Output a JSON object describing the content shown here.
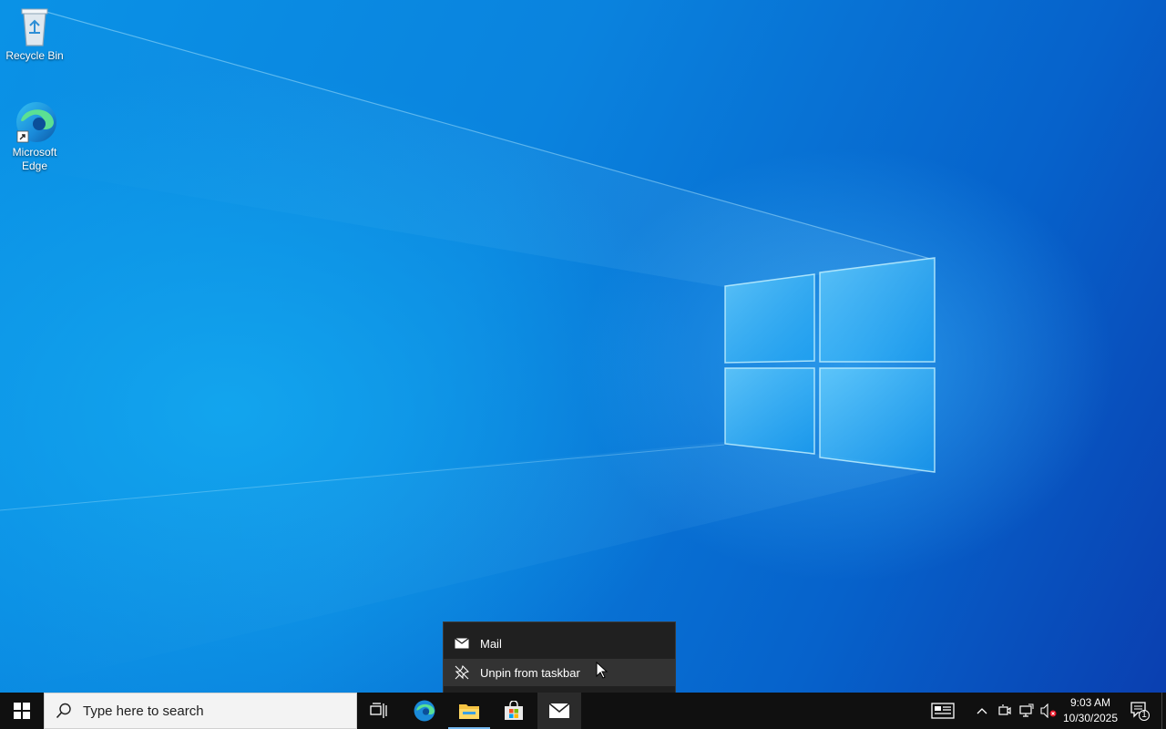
{
  "desktop": {
    "icons": [
      {
        "label_line1": "Recycle Bin",
        "icon": "recycle-bin-icon"
      },
      {
        "label_line1": "Microsoft",
        "label_line2": "Edge",
        "icon": "edge-icon"
      }
    ]
  },
  "jumplist": {
    "app_item": {
      "label": "Mail",
      "icon": "mail-icon"
    },
    "unpin_item": {
      "label": "Unpin from taskbar",
      "icon": "unpin-icon"
    }
  },
  "taskbar": {
    "start": {
      "icon": "windows-logo-icon"
    },
    "search": {
      "placeholder": "Type here to search",
      "icon": "search-icon"
    },
    "pinned": [
      {
        "name": "Task View",
        "icon": "task-view-icon"
      },
      {
        "name": "Microsoft Edge",
        "icon": "edge-icon"
      },
      {
        "name": "File Explorer",
        "icon": "file-explorer-icon",
        "running": true
      },
      {
        "name": "Microsoft Store",
        "icon": "store-icon"
      },
      {
        "name": "Mail",
        "icon": "mail-icon",
        "active": true
      }
    ],
    "tray": {
      "icons": [
        "news-icon",
        "chevron-up-icon",
        "meet-now-icon",
        "network-icon",
        "volume-muted-icon"
      ],
      "time": "9:03 AM",
      "date": "10/30/2025",
      "notification_count": "1"
    }
  },
  "colors": {
    "accent": "#75b9ef",
    "taskbar": "#101010",
    "menu_bg": "#202020"
  }
}
